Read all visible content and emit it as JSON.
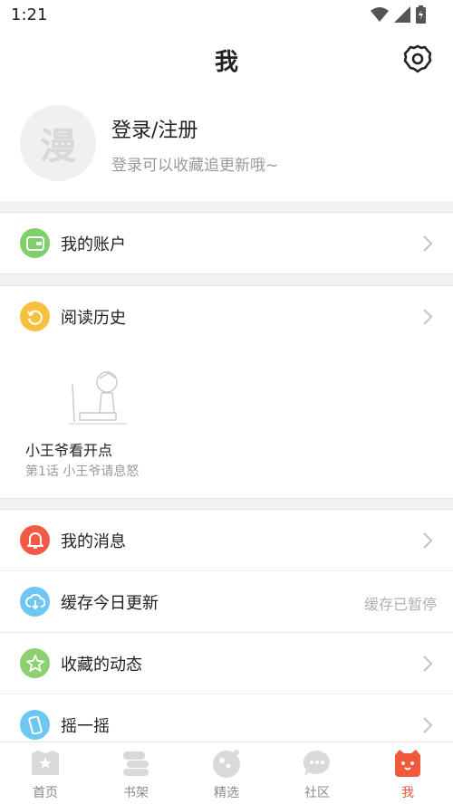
{
  "status_bar": {
    "time": "1:21"
  },
  "header": {
    "title": "我"
  },
  "profile": {
    "avatar_char": "漫",
    "login_title": "登录/注册",
    "login_subtitle": "登录可以收藏追更新哦~"
  },
  "account": {
    "label": "我的账户",
    "icon": "wallet-icon",
    "color": "#7fd06a"
  },
  "history": {
    "label": "阅读历史",
    "icon": "history-icon",
    "color": "#f8c040",
    "item": {
      "title": "小王爷看开点",
      "subtitle": "第1话  小王爷请息怒"
    }
  },
  "menu": [
    {
      "label": "我的消息",
      "icon": "bell-icon",
      "color": "#f25a45",
      "right_text": ""
    },
    {
      "label": "缓存今日更新",
      "icon": "cloud-download-icon",
      "color": "#6ec6f3",
      "right_text": "缓存已暂停"
    },
    {
      "label": "收藏的动态",
      "icon": "star-icon",
      "color": "#8cd070",
      "right_text": ""
    },
    {
      "label": "摇一摇",
      "icon": "phone-shake-icon",
      "color": "#6ec6f3",
      "right_text": ""
    }
  ],
  "tabbar": {
    "active_color": "#f05a3a",
    "tabs": [
      {
        "label": "首页",
        "icon": "home-star-icon"
      },
      {
        "label": "书架",
        "icon": "bookshelf-icon"
      },
      {
        "label": "精选",
        "icon": "featured-icon"
      },
      {
        "label": "社区",
        "icon": "chat-bubble-icon"
      },
      {
        "label": "我",
        "icon": "profile-mascot-icon",
        "active": true
      }
    ]
  }
}
